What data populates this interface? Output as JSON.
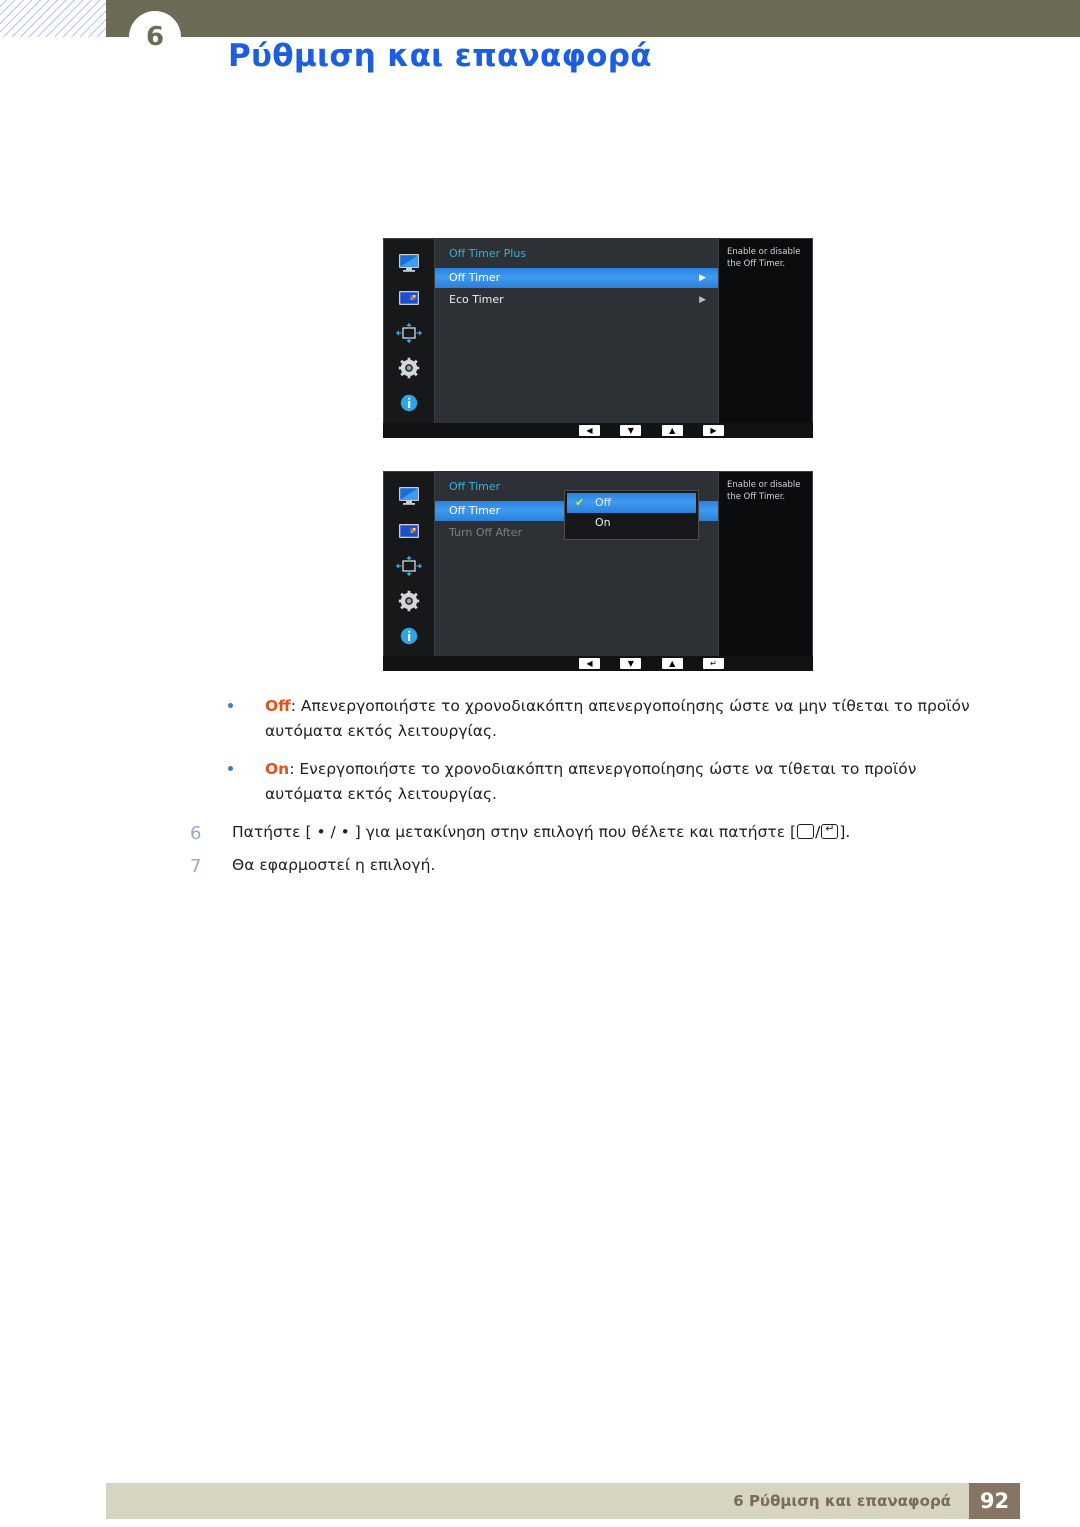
{
  "header": {
    "chapter_number": "6",
    "title": "Ρύθμιση και επαναφορά"
  },
  "osd_menus": [
    {
      "name": "off-timer-plus-menu",
      "title": "Off Timer Plus",
      "sidebar_icons": [
        "display-icon",
        "picture-color-icon",
        "screen-adjust-icon",
        "gear-icon",
        "info-icon"
      ],
      "rows": [
        {
          "label": "Off Timer",
          "arrow": "▶",
          "selected": true,
          "dimmed": false
        },
        {
          "label": "Eco Timer",
          "arrow": "▶",
          "selected": false,
          "dimmed": false
        }
      ],
      "help_text": "Enable or disable the Off Timer.",
      "nav_keys": [
        "◀",
        "▼",
        "▲",
        "▶"
      ]
    },
    {
      "name": "off-timer-menu",
      "title": "Off Timer",
      "sidebar_icons": [
        "display-icon",
        "picture-color-icon",
        "screen-adjust-icon",
        "gear-icon",
        "info-icon"
      ],
      "rows": [
        {
          "label": "Off Timer",
          "arrow": "",
          "selected": true,
          "dimmed": false
        },
        {
          "label": "Turn Off After",
          "arrow": "",
          "selected": false,
          "dimmed": true
        }
      ],
      "popup": {
        "options": [
          {
            "label": "Off",
            "checked": true,
            "selected": true,
            "check_glyph": "✔"
          },
          {
            "label": "On",
            "checked": false,
            "selected": false,
            "check_glyph": ""
          }
        ]
      },
      "help_text": "Enable or disable the Off Timer.",
      "nav_keys": [
        "◀",
        "▼",
        "▲",
        "↵"
      ]
    }
  ],
  "bullets": [
    {
      "keyword": "Off",
      "separator": ": ",
      "text": "Απενεργοποιήστε το χρονοδιακόπτη απενεργοποίησης ώστε να μην τίθεται το προϊόν αυτόματα εκτός λειτουργίας."
    },
    {
      "keyword": "On",
      "separator": ": ",
      "text": "Ενεργοποιήστε το χρονοδιακόπτη απενεργοποίησης ώστε να τίθεται το προϊόν αυτόματα εκτός λειτουργίας."
    }
  ],
  "steps": [
    {
      "number": "6",
      "text_before": "Πατήστε [ • / • ] για μετακίνηση στην επιλογή που θέλετε και πατήστε [",
      "text_middle": "/",
      "text_after": "]."
    },
    {
      "number": "7",
      "text_before": "Θα εφαρμοστεί η επιλογή.",
      "text_middle": "",
      "text_after": ""
    }
  ],
  "footer": {
    "text": "6 Ρύθμιση και επαναφορά",
    "page_number": "92"
  },
  "colors": {
    "header_bar": "#6c6b56",
    "title_blue": "#1b5fe0",
    "keyword_orange": "#e0521b",
    "osd_highlight": "#3e9bf0",
    "osd_title_cyan": "#34b3d9",
    "footer_bar": "#d8d4c2",
    "footer_page_box": "#877564"
  }
}
